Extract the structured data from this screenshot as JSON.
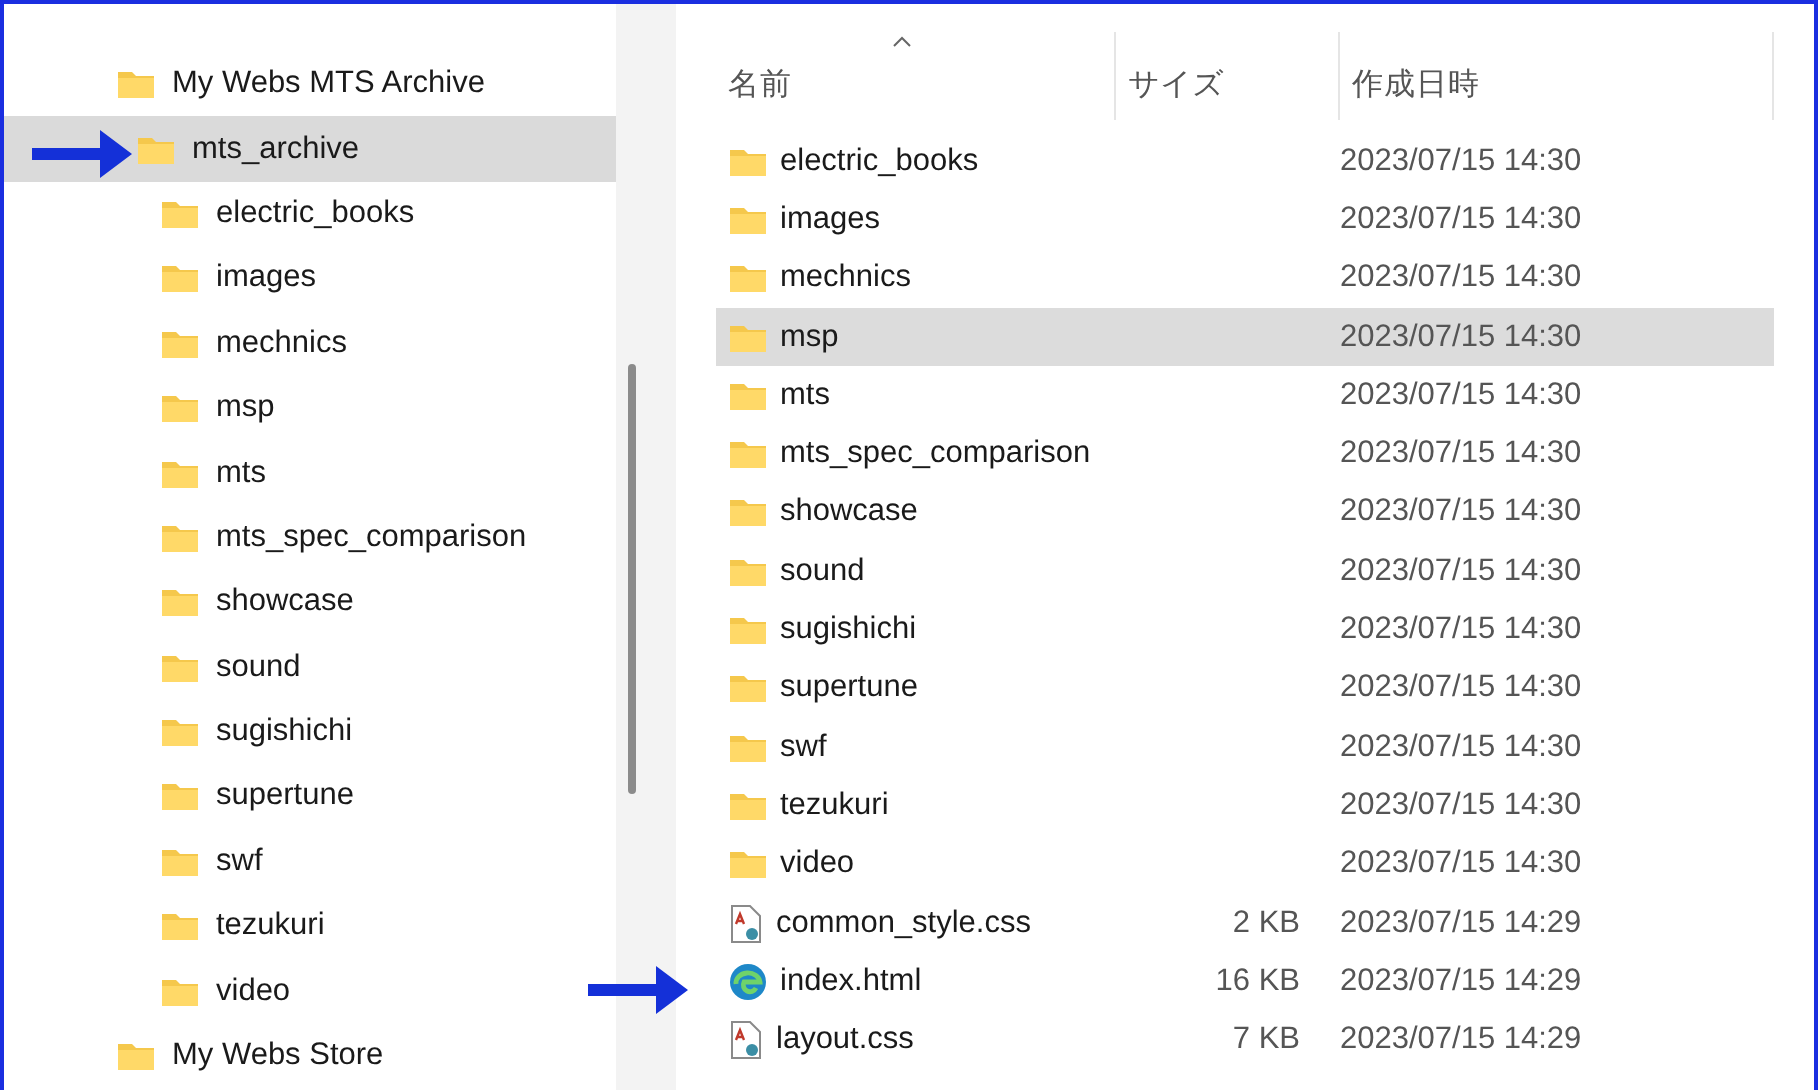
{
  "tree": [
    {
      "label": "My Webs MTS Archive",
      "selected": false,
      "children": [
        {
          "label": "mts_archive",
          "selected": true,
          "children": [
            {
              "label": "electric_books",
              "selected": false
            },
            {
              "label": "images",
              "selected": false
            },
            {
              "label": "mechnics",
              "selected": false
            },
            {
              "label": "msp",
              "selected": false
            },
            {
              "label": "mts",
              "selected": false
            },
            {
              "label": "mts_spec_comparison",
              "selected": false
            },
            {
              "label": "showcase",
              "selected": false
            },
            {
              "label": "sound",
              "selected": false
            },
            {
              "label": "sugishichi",
              "selected": false
            },
            {
              "label": "supertune",
              "selected": false
            },
            {
              "label": "swf",
              "selected": false
            },
            {
              "label": "tezukuri",
              "selected": false
            },
            {
              "label": "video",
              "selected": false
            }
          ]
        }
      ]
    },
    {
      "label": "My Webs Store",
      "selected": false
    }
  ],
  "columns": [
    {
      "label": "名前",
      "sorted": true
    },
    {
      "label": "サイズ",
      "sorted": false
    },
    {
      "label": "作成日時",
      "sorted": false
    }
  ],
  "files": [
    {
      "kind": "folder",
      "name": "electric_books",
      "date": "2023/07/15 14:30",
      "selected": false
    },
    {
      "kind": "folder",
      "name": "images",
      "date": "2023/07/15 14:30",
      "selected": false
    },
    {
      "kind": "folder",
      "name": "mechnics",
      "date": "2023/07/15 14:30",
      "selected": false
    },
    {
      "kind": "folder",
      "name": "msp",
      "date": "2023/07/15 14:30",
      "selected": true
    },
    {
      "kind": "folder",
      "name": "mts",
      "date": "2023/07/15 14:30",
      "selected": false
    },
    {
      "kind": "folder",
      "name": "mts_spec_comparison",
      "date": "2023/07/15 14:30",
      "selected": false
    },
    {
      "kind": "folder",
      "name": "showcase",
      "date": "2023/07/15 14:30",
      "selected": false
    },
    {
      "kind": "folder",
      "name": "sound",
      "date": "2023/07/15 14:30",
      "selected": false
    },
    {
      "kind": "folder",
      "name": "sugishichi",
      "date": "2023/07/15 14:30",
      "selected": false
    },
    {
      "kind": "folder",
      "name": "supertune",
      "date": "2023/07/15 14:30",
      "selected": false
    },
    {
      "kind": "folder",
      "name": "swf",
      "date": "2023/07/15 14:30",
      "selected": false
    },
    {
      "kind": "folder",
      "name": "tezukuri",
      "date": "2023/07/15 14:30",
      "selected": false
    },
    {
      "kind": "folder",
      "name": "video",
      "date": "2023/07/15 14:30",
      "selected": false
    },
    {
      "kind": "css",
      "name": "common_style.css",
      "size": "2 KB",
      "date": "2023/07/15 14:29",
      "selected": false
    },
    {
      "kind": "html",
      "name": "index.html",
      "size": "16 KB",
      "date": "2023/07/15 14:29",
      "selected": false
    },
    {
      "kind": "css",
      "name": "layout.css",
      "size": "7 KB",
      "date": "2023/07/15 14:29",
      "selected": false
    }
  ]
}
